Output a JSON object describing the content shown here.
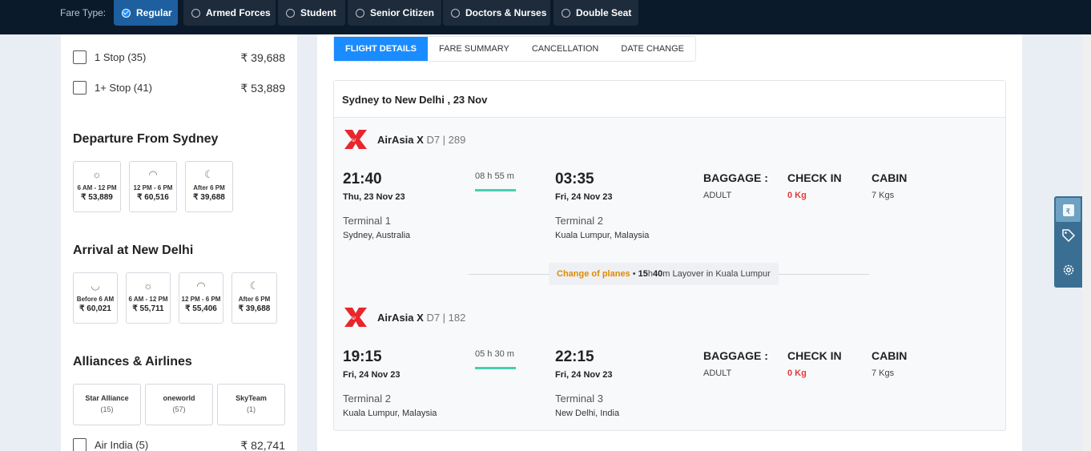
{
  "fare_type": {
    "label": "Fare Type:",
    "options": [
      "Regular",
      "Armed Forces",
      "Student",
      "Senior Citizen",
      "Doctors & Nurses",
      "Double Seat"
    ],
    "selected": "Regular"
  },
  "sidebar": {
    "stops": [
      {
        "label": "1 Stop (35)",
        "price": "₹ 39,688"
      },
      {
        "label": "1+ Stop (41)",
        "price": "₹ 53,889"
      }
    ],
    "departure": {
      "title": "Departure From Sydney",
      "slots": [
        {
          "icon": "sun-icon",
          "label": "6 AM - 12 PM",
          "price": "₹ 53,889"
        },
        {
          "icon": "sunset-icon",
          "label": "12 PM - 6 PM",
          "price": "₹ 60,516"
        },
        {
          "icon": "moon-icon",
          "label": "After 6 PM",
          "price": "₹ 39,688"
        }
      ]
    },
    "arrival": {
      "title": "Arrival at New Delhi",
      "slots": [
        {
          "icon": "sunrise-icon",
          "label": "Before 6 AM",
          "price": "₹ 60,021"
        },
        {
          "icon": "sun-icon",
          "label": "6 AM - 12 PM",
          "price": "₹ 55,711"
        },
        {
          "icon": "sunset-icon",
          "label": "12 PM - 6 PM",
          "price": "₹ 55,406"
        },
        {
          "icon": "moon-icon",
          "label": "After 6 PM",
          "price": "₹ 39,688"
        }
      ]
    },
    "alliances": {
      "title": "Alliances & Airlines",
      "items": [
        {
          "name": "Star Alliance",
          "count": "(15)"
        },
        {
          "name": "oneworld",
          "count": "(57)"
        },
        {
          "name": "SkyTeam",
          "count": "(1)"
        }
      ]
    },
    "airline_row": {
      "label": "Air India (5)",
      "price": "₹ 82,741"
    }
  },
  "main": {
    "tabs": [
      "FLIGHT DETAILS",
      "FARE SUMMARY",
      "CANCELLATION",
      "DATE CHANGE"
    ],
    "active_tab": "FLIGHT DETAILS",
    "route_title": "Sydney to New Delhi , 23 Nov",
    "segments": [
      {
        "airline": "AirAsia X",
        "code": "D7 | 289",
        "dep_time": "21:40",
        "dep_date": "Thu, 23 Nov 23",
        "dep_terminal": "Terminal 1",
        "dep_city": "Sydney, Australia",
        "duration_h": "08",
        "duration_m": "55",
        "arr_time": "03:35",
        "arr_date": "Fri, 24 Nov 23",
        "arr_terminal": "Terminal 2",
        "arr_city": "Kuala Lumpur, Malaysia",
        "baggage_label": "BAGGAGE :",
        "baggage_type": "ADULT",
        "checkin_label": "CHECK IN",
        "checkin_value": "0 Kg",
        "cabin_label": "CABIN",
        "cabin_value": "7 Kgs"
      },
      {
        "airline": "AirAsia X",
        "code": "D7 | 182",
        "dep_time": "19:15",
        "dep_date": "Fri, 24 Nov 23",
        "dep_terminal": "Terminal 2",
        "dep_city": "Kuala Lumpur, Malaysia",
        "duration_h": "05",
        "duration_m": "30",
        "arr_time": "22:15",
        "arr_date": "Fri, 24 Nov 23",
        "arr_terminal": "Terminal 3",
        "arr_city": "New Delhi, India",
        "baggage_label": "BAGGAGE :",
        "baggage_type": "ADULT",
        "checkin_label": "CHECK IN",
        "checkin_value": "0 Kg",
        "cabin_label": "CABIN",
        "cabin_value": "7 Kgs"
      }
    ],
    "layover": {
      "change_label": "Change of planes",
      "hours": "15",
      "minutes": "40",
      "text": "Layover in Kuala Lumpur"
    }
  },
  "tools": [
    "rupee-icon",
    "tag-icon",
    "gear-icon"
  ],
  "colors": {
    "accent": "#1a8cff",
    "topbar": "#0a1a2b",
    "duration_bar": "#43d0b3",
    "warning": "#e08a00",
    "checkin_red": "#e53935"
  }
}
